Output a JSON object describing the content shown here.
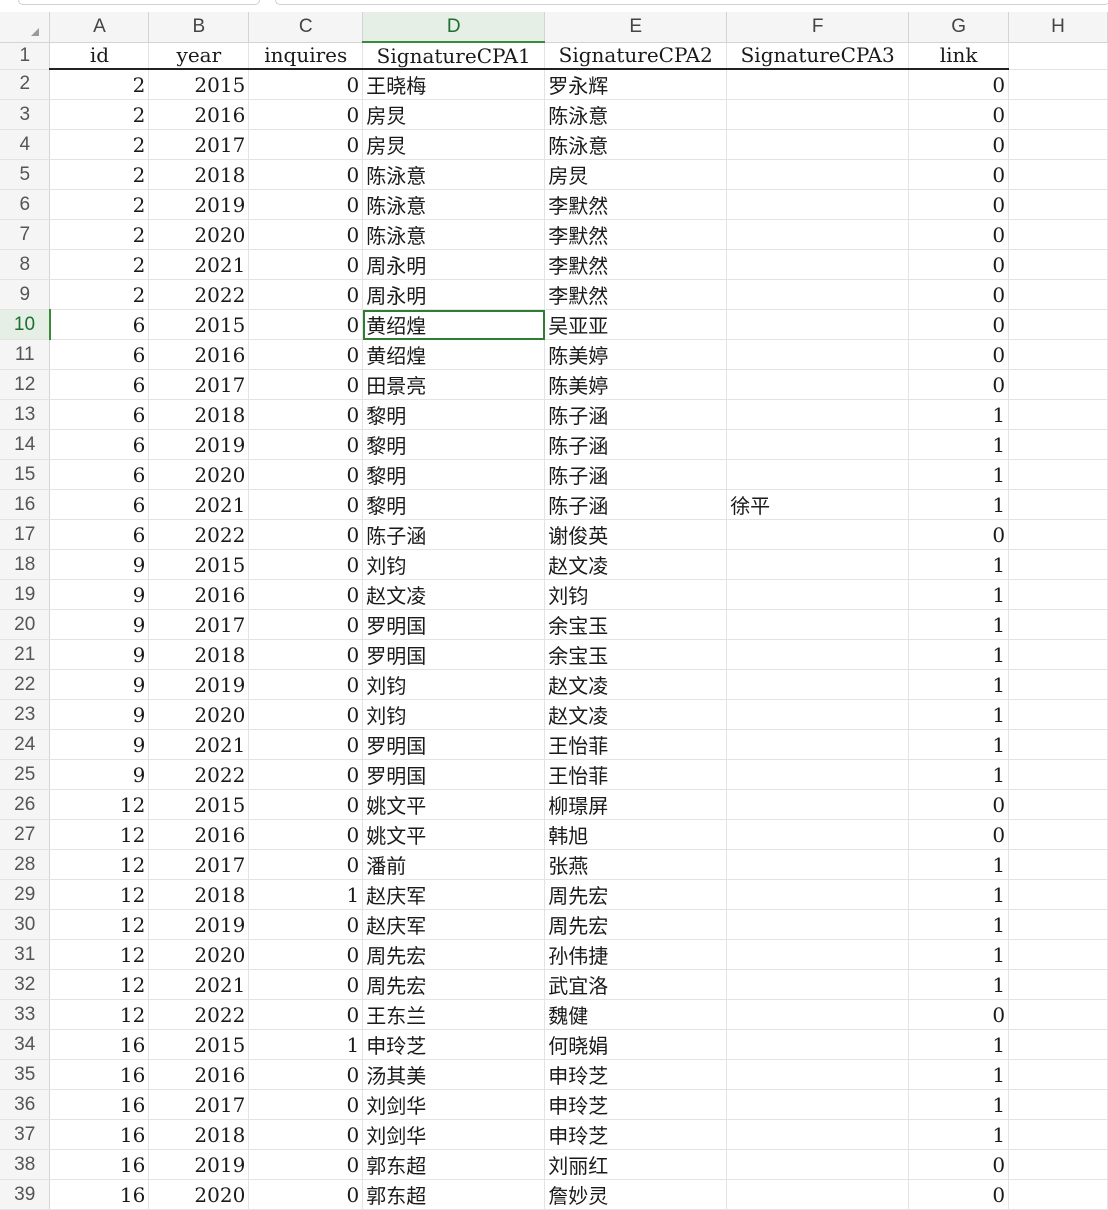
{
  "columns": [
    "A",
    "B",
    "C",
    "D",
    "E",
    "F",
    "G",
    "H"
  ],
  "selected_column": "D",
  "selected_row": "10",
  "headers": [
    "id",
    "year",
    "inquires",
    "SignatureCPA1",
    "SignatureCPA2",
    "SignatureCPA3",
    "link"
  ],
  "rows": [
    {
      "n": "2",
      "id": "2",
      "year": "2015",
      "inq": "0",
      "c1": "王晓梅",
      "c2": "罗永辉",
      "c3": "",
      "link": "0"
    },
    {
      "n": "3",
      "id": "2",
      "year": "2016",
      "inq": "0",
      "c1": "房炅",
      "c2": "陈泳意",
      "c3": "",
      "link": "0"
    },
    {
      "n": "4",
      "id": "2",
      "year": "2017",
      "inq": "0",
      "c1": "房炅",
      "c2": "陈泳意",
      "c3": "",
      "link": "0"
    },
    {
      "n": "5",
      "id": "2",
      "year": "2018",
      "inq": "0",
      "c1": "陈泳意",
      "c2": "房炅",
      "c3": "",
      "link": "0"
    },
    {
      "n": "6",
      "id": "2",
      "year": "2019",
      "inq": "0",
      "c1": "陈泳意",
      "c2": "李默然",
      "c3": "",
      "link": "0"
    },
    {
      "n": "7",
      "id": "2",
      "year": "2020",
      "inq": "0",
      "c1": "陈泳意",
      "c2": "李默然",
      "c3": "",
      "link": "0"
    },
    {
      "n": "8",
      "id": "2",
      "year": "2021",
      "inq": "0",
      "c1": "周永明",
      "c2": "李默然",
      "c3": "",
      "link": "0"
    },
    {
      "n": "9",
      "id": "2",
      "year": "2022",
      "inq": "0",
      "c1": "周永明",
      "c2": "李默然",
      "c3": "",
      "link": "0"
    },
    {
      "n": "10",
      "id": "6",
      "year": "2015",
      "inq": "0",
      "c1": "黄绍煌",
      "c2": "吴亚亚",
      "c3": "",
      "link": "0"
    },
    {
      "n": "11",
      "id": "6",
      "year": "2016",
      "inq": "0",
      "c1": "黄绍煌",
      "c2": "陈美婷",
      "c3": "",
      "link": "0"
    },
    {
      "n": "12",
      "id": "6",
      "year": "2017",
      "inq": "0",
      "c1": "田景亮",
      "c2": "陈美婷",
      "c3": "",
      "link": "0"
    },
    {
      "n": "13",
      "id": "6",
      "year": "2018",
      "inq": "0",
      "c1": "黎明",
      "c2": "陈子涵",
      "c3": "",
      "link": "1"
    },
    {
      "n": "14",
      "id": "6",
      "year": "2019",
      "inq": "0",
      "c1": "黎明",
      "c2": "陈子涵",
      "c3": "",
      "link": "1"
    },
    {
      "n": "15",
      "id": "6",
      "year": "2020",
      "inq": "0",
      "c1": "黎明",
      "c2": "陈子涵",
      "c3": "",
      "link": "1"
    },
    {
      "n": "16",
      "id": "6",
      "year": "2021",
      "inq": "0",
      "c1": "黎明",
      "c2": "陈子涵",
      "c3": "徐平",
      "link": "1"
    },
    {
      "n": "17",
      "id": "6",
      "year": "2022",
      "inq": "0",
      "c1": "陈子涵",
      "c2": "谢俊英",
      "c3": "",
      "link": "0"
    },
    {
      "n": "18",
      "id": "9",
      "year": "2015",
      "inq": "0",
      "c1": "刘钧",
      "c2": "赵文凌",
      "c3": "",
      "link": "1"
    },
    {
      "n": "19",
      "id": "9",
      "year": "2016",
      "inq": "0",
      "c1": "赵文凌",
      "c2": "刘钧",
      "c3": "",
      "link": "1"
    },
    {
      "n": "20",
      "id": "9",
      "year": "2017",
      "inq": "0",
      "c1": "罗明国",
      "c2": "余宝玉",
      "c3": "",
      "link": "1"
    },
    {
      "n": "21",
      "id": "9",
      "year": "2018",
      "inq": "0",
      "c1": "罗明国",
      "c2": "余宝玉",
      "c3": "",
      "link": "1"
    },
    {
      "n": "22",
      "id": "9",
      "year": "2019",
      "inq": "0",
      "c1": "刘钧",
      "c2": "赵文凌",
      "c3": "",
      "link": "1"
    },
    {
      "n": "23",
      "id": "9",
      "year": "2020",
      "inq": "0",
      "c1": "刘钧",
      "c2": "赵文凌",
      "c3": "",
      "link": "1"
    },
    {
      "n": "24",
      "id": "9",
      "year": "2021",
      "inq": "0",
      "c1": "罗明国",
      "c2": "王怡菲",
      "c3": "",
      "link": "1"
    },
    {
      "n": "25",
      "id": "9",
      "year": "2022",
      "inq": "0",
      "c1": "罗明国",
      "c2": "王怡菲",
      "c3": "",
      "link": "1"
    },
    {
      "n": "26",
      "id": "12",
      "year": "2015",
      "inq": "0",
      "c1": "姚文平",
      "c2": "柳璟屏",
      "c3": "",
      "link": "0"
    },
    {
      "n": "27",
      "id": "12",
      "year": "2016",
      "inq": "0",
      "c1": "姚文平",
      "c2": "韩旭",
      "c3": "",
      "link": "0"
    },
    {
      "n": "28",
      "id": "12",
      "year": "2017",
      "inq": "0",
      "c1": "潘前",
      "c2": "张燕",
      "c3": "",
      "link": "1"
    },
    {
      "n": "29",
      "id": "12",
      "year": "2018",
      "inq": "1",
      "c1": "赵庆军",
      "c2": "周先宏",
      "c3": "",
      "link": "1"
    },
    {
      "n": "30",
      "id": "12",
      "year": "2019",
      "inq": "0",
      "c1": "赵庆军",
      "c2": "周先宏",
      "c3": "",
      "link": "1"
    },
    {
      "n": "31",
      "id": "12",
      "year": "2020",
      "inq": "0",
      "c1": "周先宏",
      "c2": "孙伟捷",
      "c3": "",
      "link": "1"
    },
    {
      "n": "32",
      "id": "12",
      "year": "2021",
      "inq": "0",
      "c1": "周先宏",
      "c2": "武宜洛",
      "c3": "",
      "link": "1"
    },
    {
      "n": "33",
      "id": "12",
      "year": "2022",
      "inq": "0",
      "c1": "王东兰",
      "c2": "魏健",
      "c3": "",
      "link": "0"
    },
    {
      "n": "34",
      "id": "16",
      "year": "2015",
      "inq": "1",
      "c1": "申玲芝",
      "c2": "何晓娟",
      "c3": "",
      "link": "1"
    },
    {
      "n": "35",
      "id": "16",
      "year": "2016",
      "inq": "0",
      "c1": "汤其美",
      "c2": "申玲芝",
      "c3": "",
      "link": "1"
    },
    {
      "n": "36",
      "id": "16",
      "year": "2017",
      "inq": "0",
      "c1": "刘剑华",
      "c2": "申玲芝",
      "c3": "",
      "link": "1"
    },
    {
      "n": "37",
      "id": "16",
      "year": "2018",
      "inq": "0",
      "c1": "刘剑华",
      "c2": "申玲芝",
      "c3": "",
      "link": "1"
    },
    {
      "n": "38",
      "id": "16",
      "year": "2019",
      "inq": "0",
      "c1": "郭东超",
      "c2": "刘丽红",
      "c3": "",
      "link": "0"
    },
    {
      "n": "39",
      "id": "16",
      "year": "2020",
      "inq": "0",
      "c1": "郭东超",
      "c2": "詹妙灵",
      "c3": "",
      "link": "0"
    }
  ]
}
